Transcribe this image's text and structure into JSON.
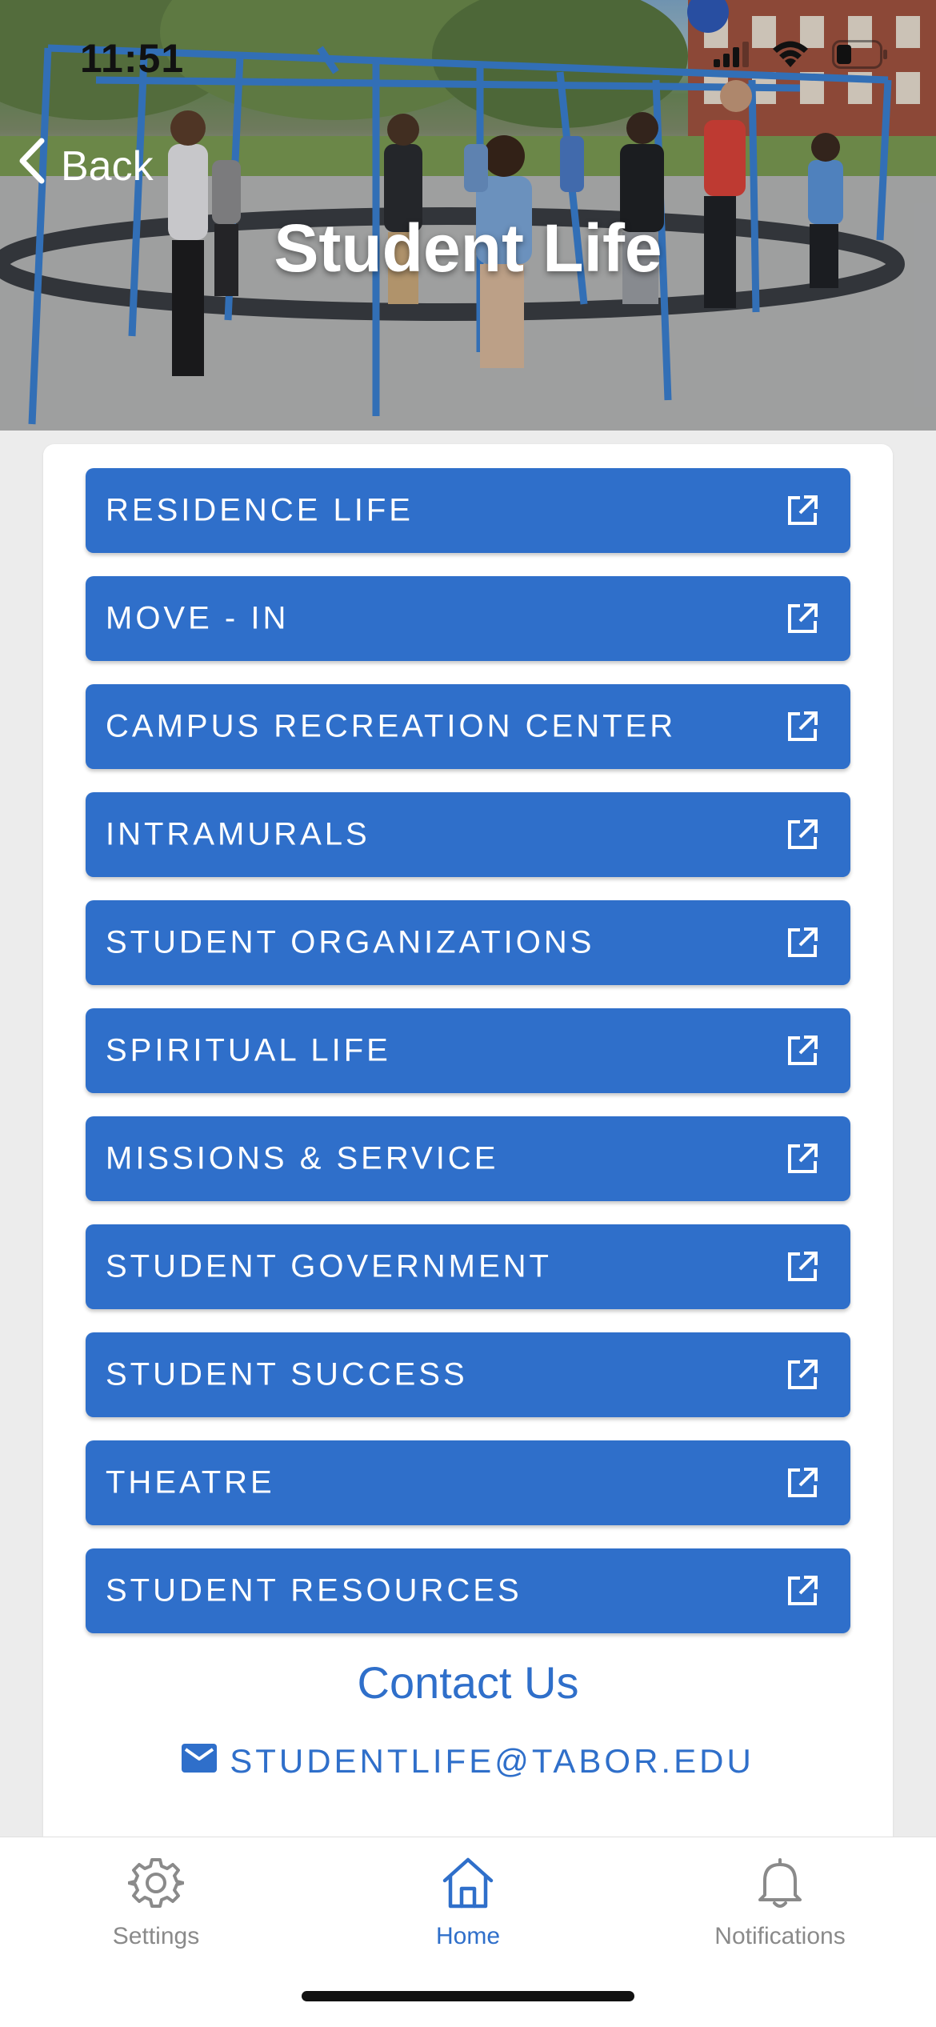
{
  "status_bar": {
    "time": "11:51",
    "icons": [
      "signal-icon",
      "wifi-icon",
      "battery-icon"
    ]
  },
  "header": {
    "back_label": "Back",
    "title": "Student Life"
  },
  "links": [
    {
      "label": "RESIDENCE LIFE",
      "icon": "external-link-icon"
    },
    {
      "label": "MOVE - IN",
      "icon": "external-link-icon"
    },
    {
      "label": "CAMPUS RECREATION CENTER",
      "icon": "external-link-icon"
    },
    {
      "label": "INTRAMURALS",
      "icon": "external-link-icon"
    },
    {
      "label": "STUDENT ORGANIZATIONS",
      "icon": "external-link-icon"
    },
    {
      "label": "SPIRITUAL LIFE",
      "icon": "external-link-icon"
    },
    {
      "label": "MISSIONS & SERVICE",
      "icon": "external-link-icon"
    },
    {
      "label": "STUDENT GOVERNMENT",
      "icon": "external-link-icon"
    },
    {
      "label": "STUDENT SUCCESS",
      "icon": "external-link-icon"
    },
    {
      "label": "THEATRE",
      "icon": "external-link-icon"
    },
    {
      "label": "STUDENT RESOURCES",
      "icon": "external-link-icon"
    }
  ],
  "contact": {
    "title": "Contact Us",
    "email": "STUDENTLIFE@TABOR.EDU",
    "icon": "mail-icon"
  },
  "tabbar": {
    "tabs": [
      {
        "label": "Settings",
        "icon": "gear-icon",
        "active": false
      },
      {
        "label": "Home",
        "icon": "home-icon",
        "active": true
      },
      {
        "label": "Notifications",
        "icon": "bell-icon",
        "active": false
      }
    ]
  },
  "colors": {
    "accent": "#2f6fca",
    "background": "#ececec",
    "card": "#ffffff",
    "inactive_tab": "#8a8a8a"
  }
}
